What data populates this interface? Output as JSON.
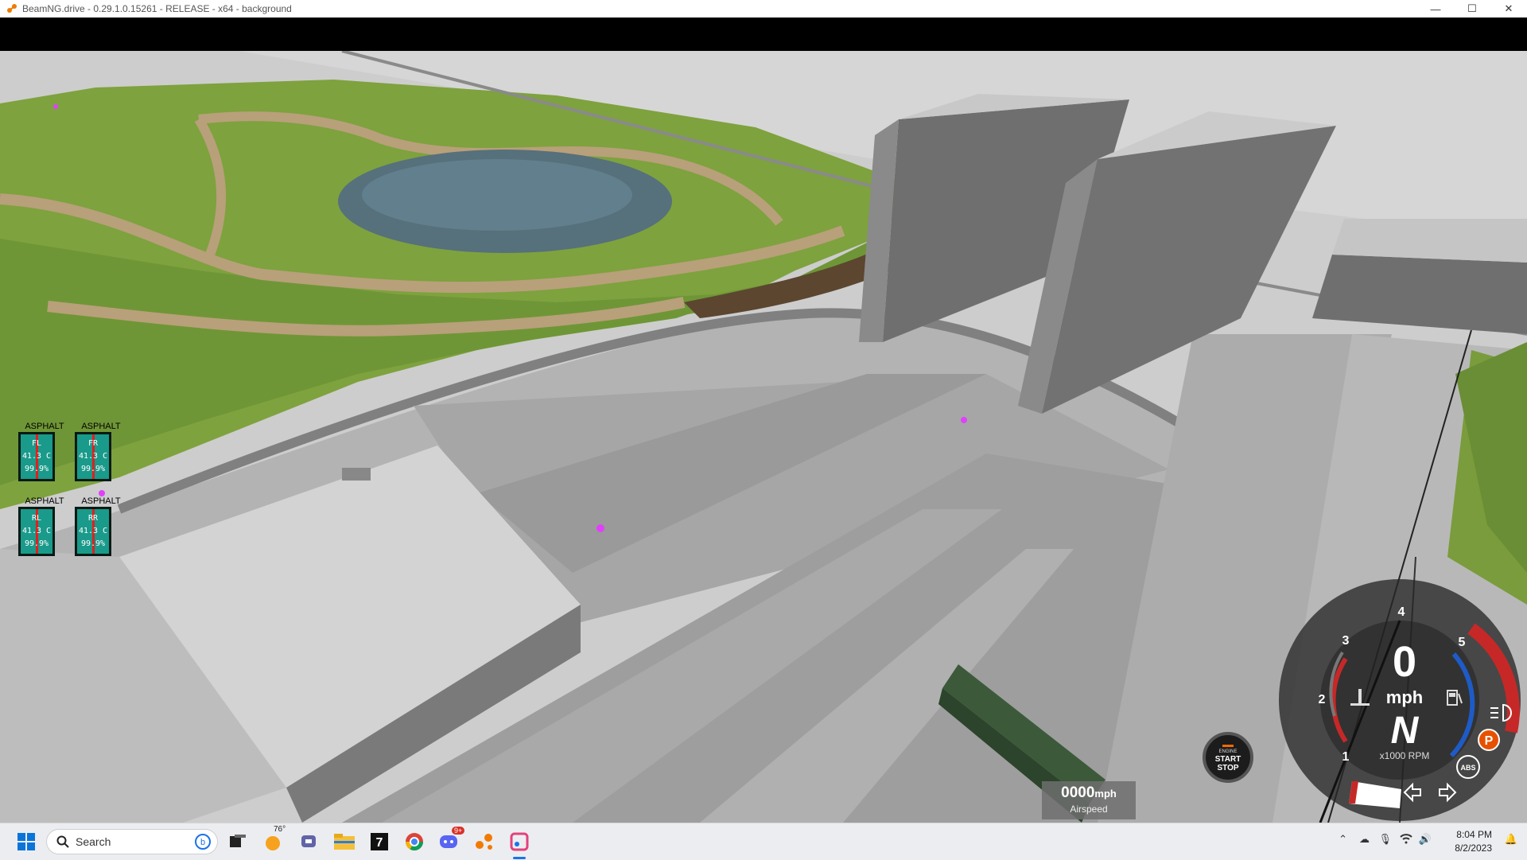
{
  "window": {
    "title": "BeamNG.drive - 0.29.1.0.15261 - RELEASE - x64 - background",
    "controls": {
      "minimize": "—",
      "maximize": "☐",
      "close": "✕"
    }
  },
  "tires": [
    {
      "surface": "ASPHALT",
      "label": "FL",
      "temp": "41.3 C",
      "wear": "99.9%"
    },
    {
      "surface": "ASPHALT",
      "label": "FR",
      "temp": "41.3 C",
      "wear": "99.9%"
    },
    {
      "surface": "ASPHALT",
      "label": "RL",
      "temp": "41.3 C",
      "wear": "99.9%"
    },
    {
      "surface": "ASPHALT",
      "label": "RR",
      "temp": "41.3 C",
      "wear": "99.9%"
    }
  ],
  "engine_button": {
    "line1": "ENGINE",
    "line2": "START",
    "line3": "STOP"
  },
  "airspeed": {
    "value": "0000",
    "unit": "mph",
    "label": "Airspeed"
  },
  "dashboard": {
    "speed": "0",
    "speed_unit": "mph",
    "gear": "N",
    "rpm_label": "x1000 RPM",
    "tach_ticks": [
      "1",
      "2",
      "3",
      "4",
      "5"
    ],
    "abs_label": "ABS",
    "parking_label": "P",
    "colors": {
      "redline": "#c62828",
      "blue_arc": "#1e5bc6",
      "parking": "#e65100"
    }
  },
  "taskbar": {
    "search_label": "Search",
    "weather": "76°",
    "discord_badge": "9+",
    "time": "8:04 PM",
    "date": "8/2/2023",
    "icons": [
      "windows-start-icon",
      "search-icon",
      "bing-icon",
      "task-view-icon",
      "weather-icon",
      "teams-icon",
      "file-explorer-icon",
      "app-7-icon",
      "chrome-icon",
      "discord-icon",
      "beamng-icon",
      "snipping-tool-icon"
    ]
  }
}
